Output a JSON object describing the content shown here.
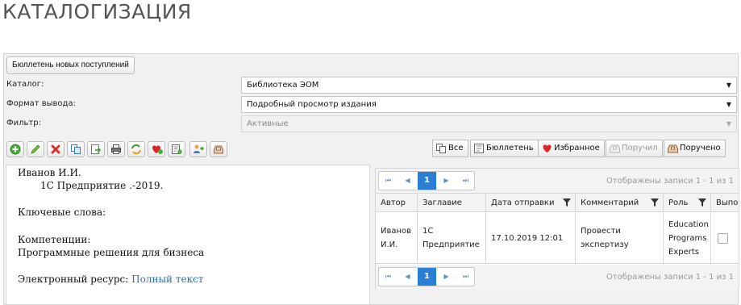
{
  "page": {
    "title": "КАТАЛОГИЗАЦИЯ"
  },
  "form": {
    "bulletin_button": "Бюллетень новых поступлений",
    "catalog": {
      "label": "Каталог:",
      "value": "Библиотека ЭОМ"
    },
    "output_format": {
      "label": "Формат вывода:",
      "value": "Подробный просмотр издания"
    },
    "filter": {
      "label": "Фильтр:",
      "value": "Активные"
    }
  },
  "toolbar": {
    "icons": [
      "add-icon",
      "edit-icon",
      "delete-icon",
      "copy-icon",
      "export-icon",
      "print-icon",
      "refresh-icon",
      "favorite-add-icon",
      "bulletin-add-icon",
      "send-user-icon",
      "inbox-icon"
    ]
  },
  "filters": {
    "all": "Все",
    "bulletin": "Бюллетень",
    "favorites": "Избранное",
    "received": "Поручил",
    "assigned": "Поручено"
  },
  "record": {
    "author": "Иванов И.И.",
    "title_line": "1С Предприятие .-2019.",
    "keywords_label": "Ключевые слова:",
    "competencies_label": "Компетенции:",
    "competencies_value": "Программные решения для бизнеса",
    "resource_label": "Электронный ресурс:",
    "resource_link": "Полный текст"
  },
  "grid": {
    "pager": {
      "first": "⏮",
      "prev": "◀",
      "current_page": "1",
      "next": "▶",
      "last": "⏭",
      "info": "Отображены записи 1 - 1 из 1"
    },
    "columns": [
      "Автор",
      "Заглавие",
      "Дата отправки",
      "Комментарий",
      "Роль",
      "Выпо"
    ],
    "rows": [
      {
        "author_line1": "Иванов",
        "author_line2": "И.И.",
        "title_line1": "1С",
        "title_line2": "Предприятие",
        "date": "17.10.2019 12:01",
        "comment_line1": "Провести",
        "comment_line2": "экспертизу",
        "role_line1": "Education",
        "role_line2": "Programs",
        "role_line3": "Experts",
        "done": false
      }
    ]
  },
  "colors": {
    "accent": "#2a7fd4",
    "link": "#2a6fb5",
    "heart": "#e0242b"
  }
}
